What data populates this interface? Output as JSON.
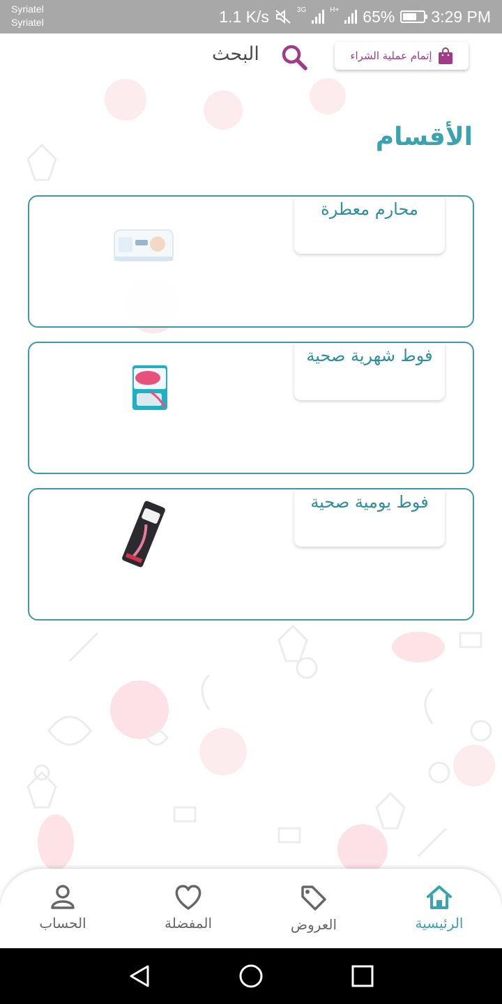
{
  "status_bar": {
    "carrier_1": "Syriatel",
    "carrier_2": "Syriatel",
    "speed": "1.1 K/s",
    "network": "3G",
    "network2": "H+",
    "battery": "65%",
    "battery_level": 0.65,
    "time": "3:29 PM"
  },
  "header": {
    "checkout_label": "إتمام عملية الشراء",
    "search_label": "البحث"
  },
  "section_title": "الأقسام",
  "categories": [
    {
      "label": "محارم معطرة",
      "product_icon": "wet-wipes-pack"
    },
    {
      "label": "فوط شهرية صحية",
      "product_icon": "sanitary-pads-pack"
    },
    {
      "label": "فوط يومية صحية",
      "product_icon": "panty-liner-pack"
    }
  ],
  "bottom_nav": [
    {
      "label": "الرئيسية",
      "icon": "home-icon",
      "active": true
    },
    {
      "label": "العروض",
      "icon": "tag-icon",
      "active": false
    },
    {
      "label": "المفضلة",
      "icon": "heart-icon",
      "active": false
    },
    {
      "label": "الحساب",
      "icon": "user-icon",
      "active": false
    }
  ],
  "colors": {
    "accent": "#3aa3b0",
    "brand": "#a03a89",
    "card_border": "#3a9aa6",
    "status_bar": "#a8a8a8"
  }
}
